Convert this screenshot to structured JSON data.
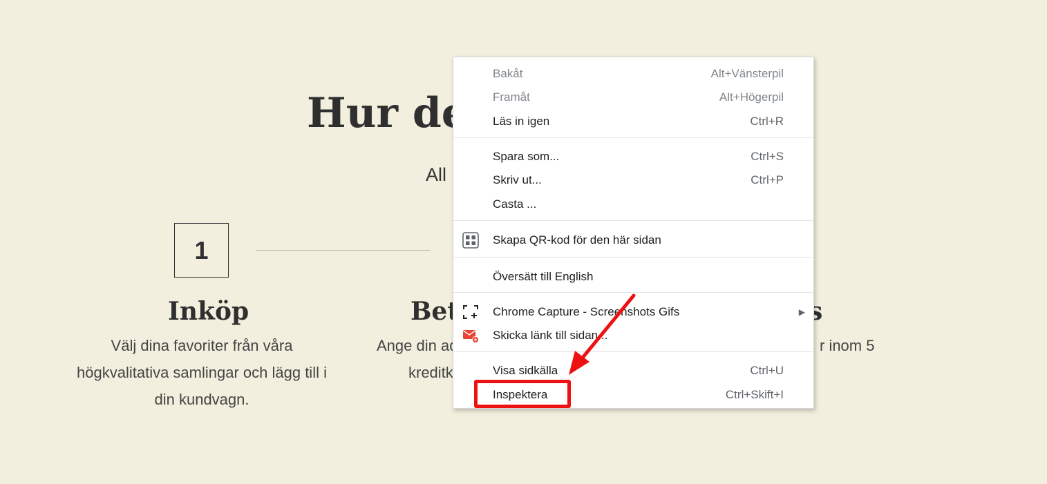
{
  "page": {
    "heading": "Hur de",
    "subtitle": "All",
    "step1": {
      "number": "1",
      "title": "Inköp",
      "text": "Välj dina favoriter från våra högkvalitativa samlingar och lägg till i din kundvagn."
    },
    "step2": {
      "title": "Beta",
      "line1": "Ange din ad",
      "line2": "kreditk"
    },
    "step3": {
      "title_tail": "s",
      "text_tail": "r inom 5"
    }
  },
  "context_menu": {
    "items": [
      {
        "label": "Bakåt",
        "shortcut": "Alt+Vänsterpil",
        "disabled": true
      },
      {
        "label": "Framåt",
        "shortcut": "Alt+Högerpil",
        "disabled": true
      },
      {
        "label": "Läs in igen",
        "shortcut": "Ctrl+R"
      },
      {
        "label": "Spara som...",
        "shortcut": "Ctrl+S"
      },
      {
        "label": "Skriv ut...",
        "shortcut": "Ctrl+P"
      },
      {
        "label": "Casta ...",
        "shortcut": ""
      },
      {
        "label": "Skapa QR-kod för den här sidan",
        "shortcut": "",
        "icon": "qr-code-icon"
      },
      {
        "label": "Översätt till English",
        "shortcut": ""
      },
      {
        "label": "Chrome Capture - Screenshots  Gifs",
        "shortcut": "",
        "icon": "capture-icon",
        "submenu": true
      },
      {
        "label": "Skicka länk till sidan...",
        "shortcut": "",
        "icon": "send-link-icon"
      },
      {
        "label": "Visa sidkälla",
        "shortcut": "Ctrl+U"
      },
      {
        "label": "Inspektera",
        "shortcut": "Ctrl+Skift+I"
      }
    ]
  },
  "annotation": {
    "highlight_color": "#ee1111",
    "highlighted_item": "Inspektera"
  },
  "colors": {
    "background": "#f3efde",
    "menu_bg": "#ffffff",
    "text_dark": "#2f2f2f"
  }
}
